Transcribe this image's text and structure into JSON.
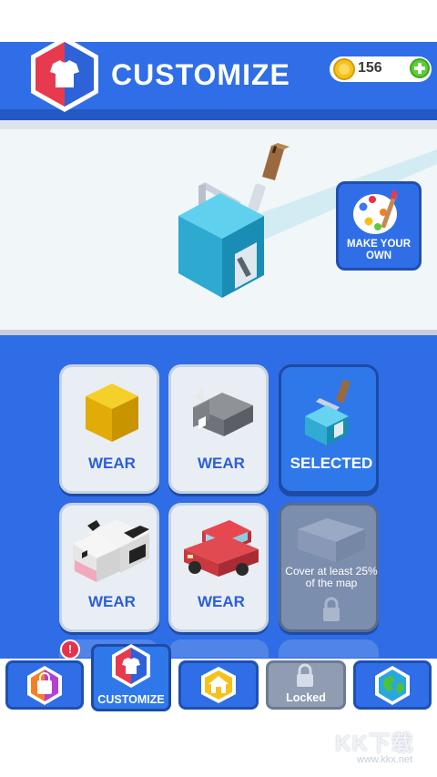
{
  "header": {
    "title": "CUSTOMIZE",
    "coins": "156",
    "logo_icon": "tshirt-hex-icon",
    "coin_icon": "coin-icon",
    "add_icon": "plus-icon"
  },
  "preview": {
    "make_own_label": "MAKE YOUR OWN",
    "make_own_icon": "palette-brush-icon"
  },
  "skins": [
    {
      "label": "WEAR",
      "icon": "yellow-cube-icon"
    },
    {
      "label": "WEAR",
      "icon": "rhino-icon"
    },
    {
      "label": "SELECTED",
      "icon": "paint-roller-cube-icon"
    },
    {
      "label": "WEAR",
      "icon": "cow-icon"
    },
    {
      "label": "WEAR",
      "icon": "red-car-icon"
    },
    {
      "label": "Cover at least 25% of the map",
      "icon": "lock-icon"
    }
  ],
  "nav": {
    "shop_badge": "!",
    "customize_label": "CUSTOMIZE",
    "locked_label": "Locked",
    "items": [
      "shop-bag-icon",
      "tshirt-icon",
      "home-icon",
      "lock-icon",
      "globe-icon"
    ]
  },
  "watermark": {
    "main": "KK下载",
    "sub": "www.kkx.net"
  },
  "colors": {
    "primary": "#2f6ee6",
    "coin": "#f4c21b",
    "plus": "#5ccd35",
    "badge": "#e8314a"
  }
}
